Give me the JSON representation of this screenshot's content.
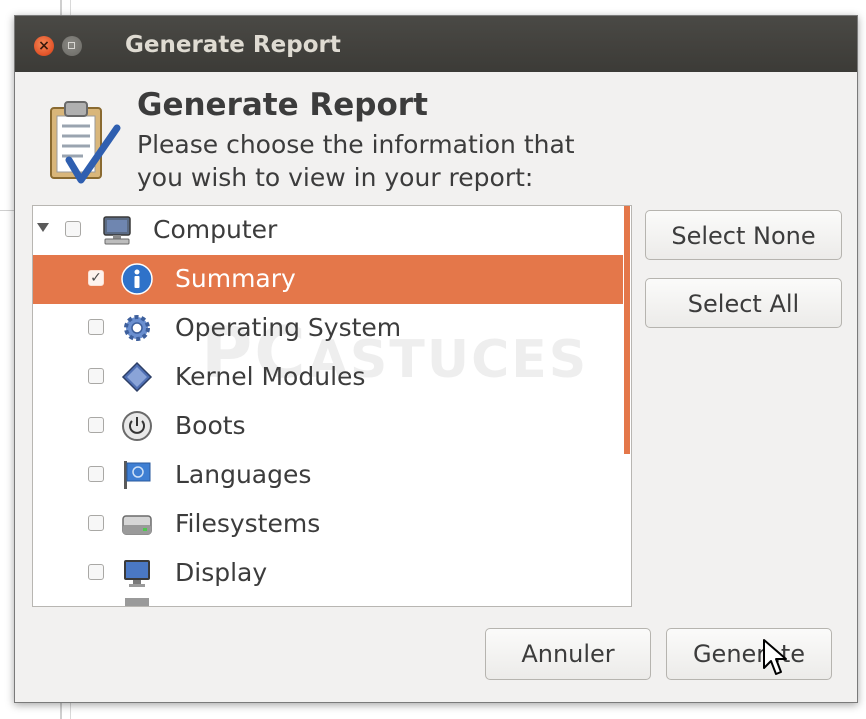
{
  "window": {
    "title": "Generate Report"
  },
  "header": {
    "title": "Generate Report",
    "subtitle_line1": "Please choose the information that",
    "subtitle_line2": "you wish to view in your report:"
  },
  "tree": {
    "items": [
      {
        "label": "Computer",
        "icon": "computer-icon",
        "checked": false,
        "expanded": true
      },
      {
        "label": "Summary",
        "icon": "info-icon",
        "checked": true,
        "selected": true
      },
      {
        "label": "Operating System",
        "icon": "gear-icon",
        "checked": false
      },
      {
        "label": "Kernel Modules",
        "icon": "diamond-module-icon",
        "checked": false
      },
      {
        "label": "Boots",
        "icon": "power-icon",
        "checked": false
      },
      {
        "label": "Languages",
        "icon": "flag-icon",
        "checked": false
      },
      {
        "label": "Filesystems",
        "icon": "drive-icon",
        "checked": false
      },
      {
        "label": "Display",
        "icon": "monitor-icon",
        "checked": false
      }
    ]
  },
  "buttons": {
    "select_none": "Select None",
    "select_all": "Select All",
    "cancel": "Annuler",
    "generate": "Generate"
  },
  "watermark": {
    "text_big": "PC",
    "text_small": "ASTUCES"
  },
  "colors": {
    "accent": "#e4774a",
    "titlebar": "#3c3b37",
    "dialog_bg": "#f2f1f0"
  }
}
